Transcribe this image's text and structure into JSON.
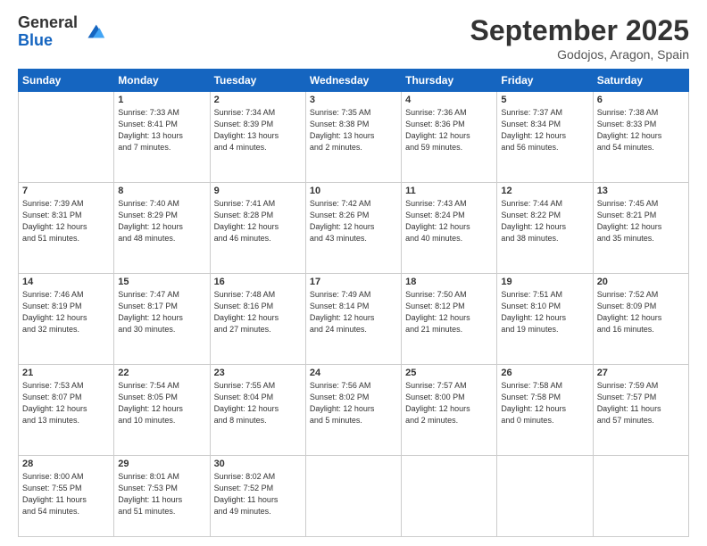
{
  "header": {
    "logo_general": "General",
    "logo_blue": "Blue",
    "month_title": "September 2025",
    "location": "Godojos, Aragon, Spain"
  },
  "days_of_week": [
    "Sunday",
    "Monday",
    "Tuesday",
    "Wednesday",
    "Thursday",
    "Friday",
    "Saturday"
  ],
  "weeks": [
    [
      {
        "day": "",
        "info": ""
      },
      {
        "day": "1",
        "info": "Sunrise: 7:33 AM\nSunset: 8:41 PM\nDaylight: 13 hours\nand 7 minutes."
      },
      {
        "day": "2",
        "info": "Sunrise: 7:34 AM\nSunset: 8:39 PM\nDaylight: 13 hours\nand 4 minutes."
      },
      {
        "day": "3",
        "info": "Sunrise: 7:35 AM\nSunset: 8:38 PM\nDaylight: 13 hours\nand 2 minutes."
      },
      {
        "day": "4",
        "info": "Sunrise: 7:36 AM\nSunset: 8:36 PM\nDaylight: 12 hours\nand 59 minutes."
      },
      {
        "day": "5",
        "info": "Sunrise: 7:37 AM\nSunset: 8:34 PM\nDaylight: 12 hours\nand 56 minutes."
      },
      {
        "day": "6",
        "info": "Sunrise: 7:38 AM\nSunset: 8:33 PM\nDaylight: 12 hours\nand 54 minutes."
      }
    ],
    [
      {
        "day": "7",
        "info": "Sunrise: 7:39 AM\nSunset: 8:31 PM\nDaylight: 12 hours\nand 51 minutes."
      },
      {
        "day": "8",
        "info": "Sunrise: 7:40 AM\nSunset: 8:29 PM\nDaylight: 12 hours\nand 48 minutes."
      },
      {
        "day": "9",
        "info": "Sunrise: 7:41 AM\nSunset: 8:28 PM\nDaylight: 12 hours\nand 46 minutes."
      },
      {
        "day": "10",
        "info": "Sunrise: 7:42 AM\nSunset: 8:26 PM\nDaylight: 12 hours\nand 43 minutes."
      },
      {
        "day": "11",
        "info": "Sunrise: 7:43 AM\nSunset: 8:24 PM\nDaylight: 12 hours\nand 40 minutes."
      },
      {
        "day": "12",
        "info": "Sunrise: 7:44 AM\nSunset: 8:22 PM\nDaylight: 12 hours\nand 38 minutes."
      },
      {
        "day": "13",
        "info": "Sunrise: 7:45 AM\nSunset: 8:21 PM\nDaylight: 12 hours\nand 35 minutes."
      }
    ],
    [
      {
        "day": "14",
        "info": "Sunrise: 7:46 AM\nSunset: 8:19 PM\nDaylight: 12 hours\nand 32 minutes."
      },
      {
        "day": "15",
        "info": "Sunrise: 7:47 AM\nSunset: 8:17 PM\nDaylight: 12 hours\nand 30 minutes."
      },
      {
        "day": "16",
        "info": "Sunrise: 7:48 AM\nSunset: 8:16 PM\nDaylight: 12 hours\nand 27 minutes."
      },
      {
        "day": "17",
        "info": "Sunrise: 7:49 AM\nSunset: 8:14 PM\nDaylight: 12 hours\nand 24 minutes."
      },
      {
        "day": "18",
        "info": "Sunrise: 7:50 AM\nSunset: 8:12 PM\nDaylight: 12 hours\nand 21 minutes."
      },
      {
        "day": "19",
        "info": "Sunrise: 7:51 AM\nSunset: 8:10 PM\nDaylight: 12 hours\nand 19 minutes."
      },
      {
        "day": "20",
        "info": "Sunrise: 7:52 AM\nSunset: 8:09 PM\nDaylight: 12 hours\nand 16 minutes."
      }
    ],
    [
      {
        "day": "21",
        "info": "Sunrise: 7:53 AM\nSunset: 8:07 PM\nDaylight: 12 hours\nand 13 minutes."
      },
      {
        "day": "22",
        "info": "Sunrise: 7:54 AM\nSunset: 8:05 PM\nDaylight: 12 hours\nand 10 minutes."
      },
      {
        "day": "23",
        "info": "Sunrise: 7:55 AM\nSunset: 8:04 PM\nDaylight: 12 hours\nand 8 minutes."
      },
      {
        "day": "24",
        "info": "Sunrise: 7:56 AM\nSunset: 8:02 PM\nDaylight: 12 hours\nand 5 minutes."
      },
      {
        "day": "25",
        "info": "Sunrise: 7:57 AM\nSunset: 8:00 PM\nDaylight: 12 hours\nand 2 minutes."
      },
      {
        "day": "26",
        "info": "Sunrise: 7:58 AM\nSunset: 7:58 PM\nDaylight: 12 hours\nand 0 minutes."
      },
      {
        "day": "27",
        "info": "Sunrise: 7:59 AM\nSunset: 7:57 PM\nDaylight: 11 hours\nand 57 minutes."
      }
    ],
    [
      {
        "day": "28",
        "info": "Sunrise: 8:00 AM\nSunset: 7:55 PM\nDaylight: 11 hours\nand 54 minutes."
      },
      {
        "day": "29",
        "info": "Sunrise: 8:01 AM\nSunset: 7:53 PM\nDaylight: 11 hours\nand 51 minutes."
      },
      {
        "day": "30",
        "info": "Sunrise: 8:02 AM\nSunset: 7:52 PM\nDaylight: 11 hours\nand 49 minutes."
      },
      {
        "day": "",
        "info": ""
      },
      {
        "day": "",
        "info": ""
      },
      {
        "day": "",
        "info": ""
      },
      {
        "day": "",
        "info": ""
      }
    ]
  ]
}
